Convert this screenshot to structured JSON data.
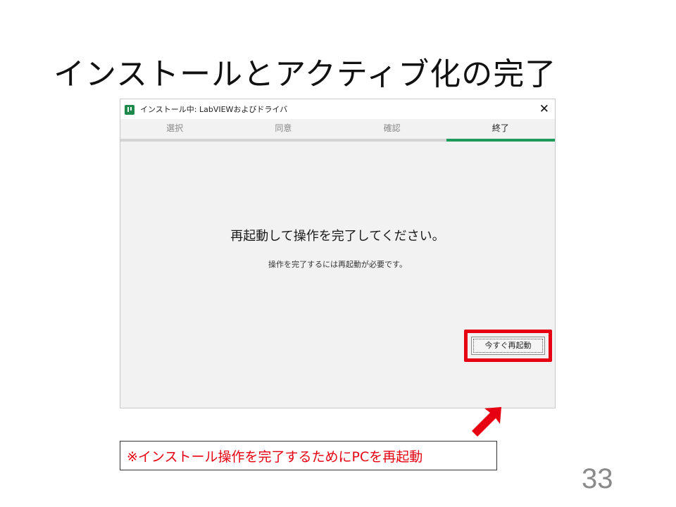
{
  "slide": {
    "title": "インストールとアクティブ化の完了",
    "page_number": "33"
  },
  "window": {
    "title": "インストール中: LabVIEWおよびドライバ",
    "app_icon": "ni-package-manager-icon",
    "close_glyph": "✕",
    "tabs": [
      {
        "label": "選択",
        "active": false
      },
      {
        "label": "同意",
        "active": false
      },
      {
        "label": "確認",
        "active": false
      },
      {
        "label": "終了",
        "active": true
      }
    ],
    "main_message": "再起動して操作を完了してください。",
    "sub_message": "操作を完了するには再起動が必要です。",
    "restart_button_label": "今すぐ再起動"
  },
  "annotation": {
    "note": "※インストール操作を完了するためにPCを再起動",
    "highlight_color": "#e60012",
    "arrow_color": "#e60012"
  },
  "colors": {
    "accent_tab": "#1e9a5c",
    "app_icon": "#1e8a4c"
  }
}
